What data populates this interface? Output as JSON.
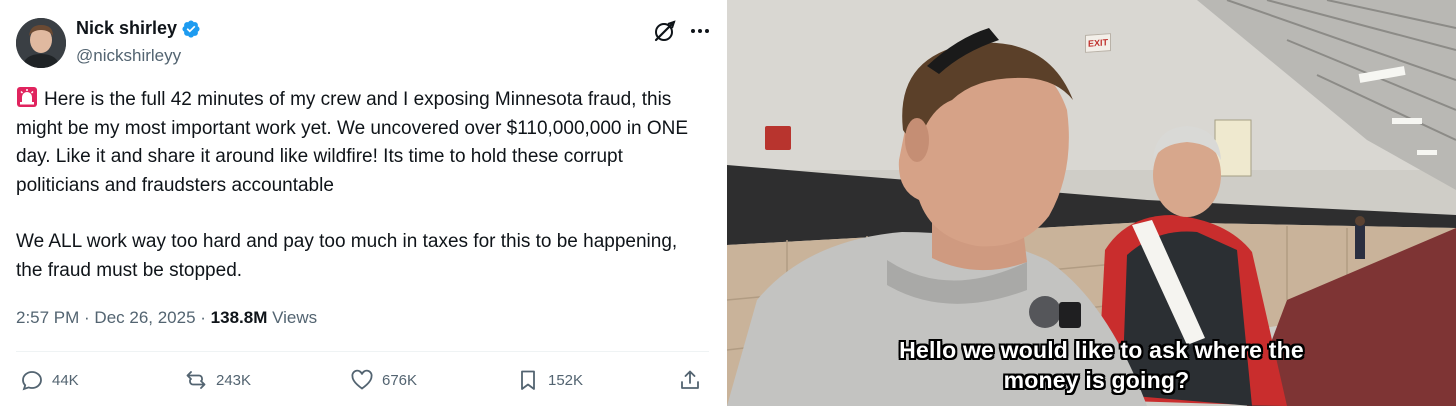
{
  "tweet": {
    "author": {
      "display_name": "Nick shirley",
      "handle": "@nickshirleyy",
      "verified": true
    },
    "paragraphs": [
      "Here is the full 42 minutes of my crew and I exposing Minnesota fraud, this might be my most important work yet. We uncovered over $110,000,000 in ONE day. Like it and share it around like wildfire! Its time to hold these corrupt politicians and fraudsters accountable",
      "We ALL work way too hard and pay too much in taxes for this to be happening, the fraud must be stopped."
    ],
    "leading_emoji": "siren-emoji",
    "timestamp": "2:57 PM · Dec 26, 2025 · ",
    "views_count": "138.8M",
    "views_label": " Views",
    "actions": {
      "replies": "44K",
      "reposts": "243K",
      "likes": "676K",
      "bookmarks": "152K"
    },
    "icons": [
      "grok-icon",
      "more-icon",
      "reply-icon",
      "repost-icon",
      "like-icon",
      "bookmark-icon",
      "share-icon"
    ],
    "colors": {
      "verified": "#1d9bf0",
      "text": "#0f1419",
      "secondary": "#536471"
    }
  },
  "video": {
    "exit_sign": "EXIT",
    "subtitle_line1": "Hello we would like to ask where the",
    "subtitle_line2": "money is going?"
  }
}
